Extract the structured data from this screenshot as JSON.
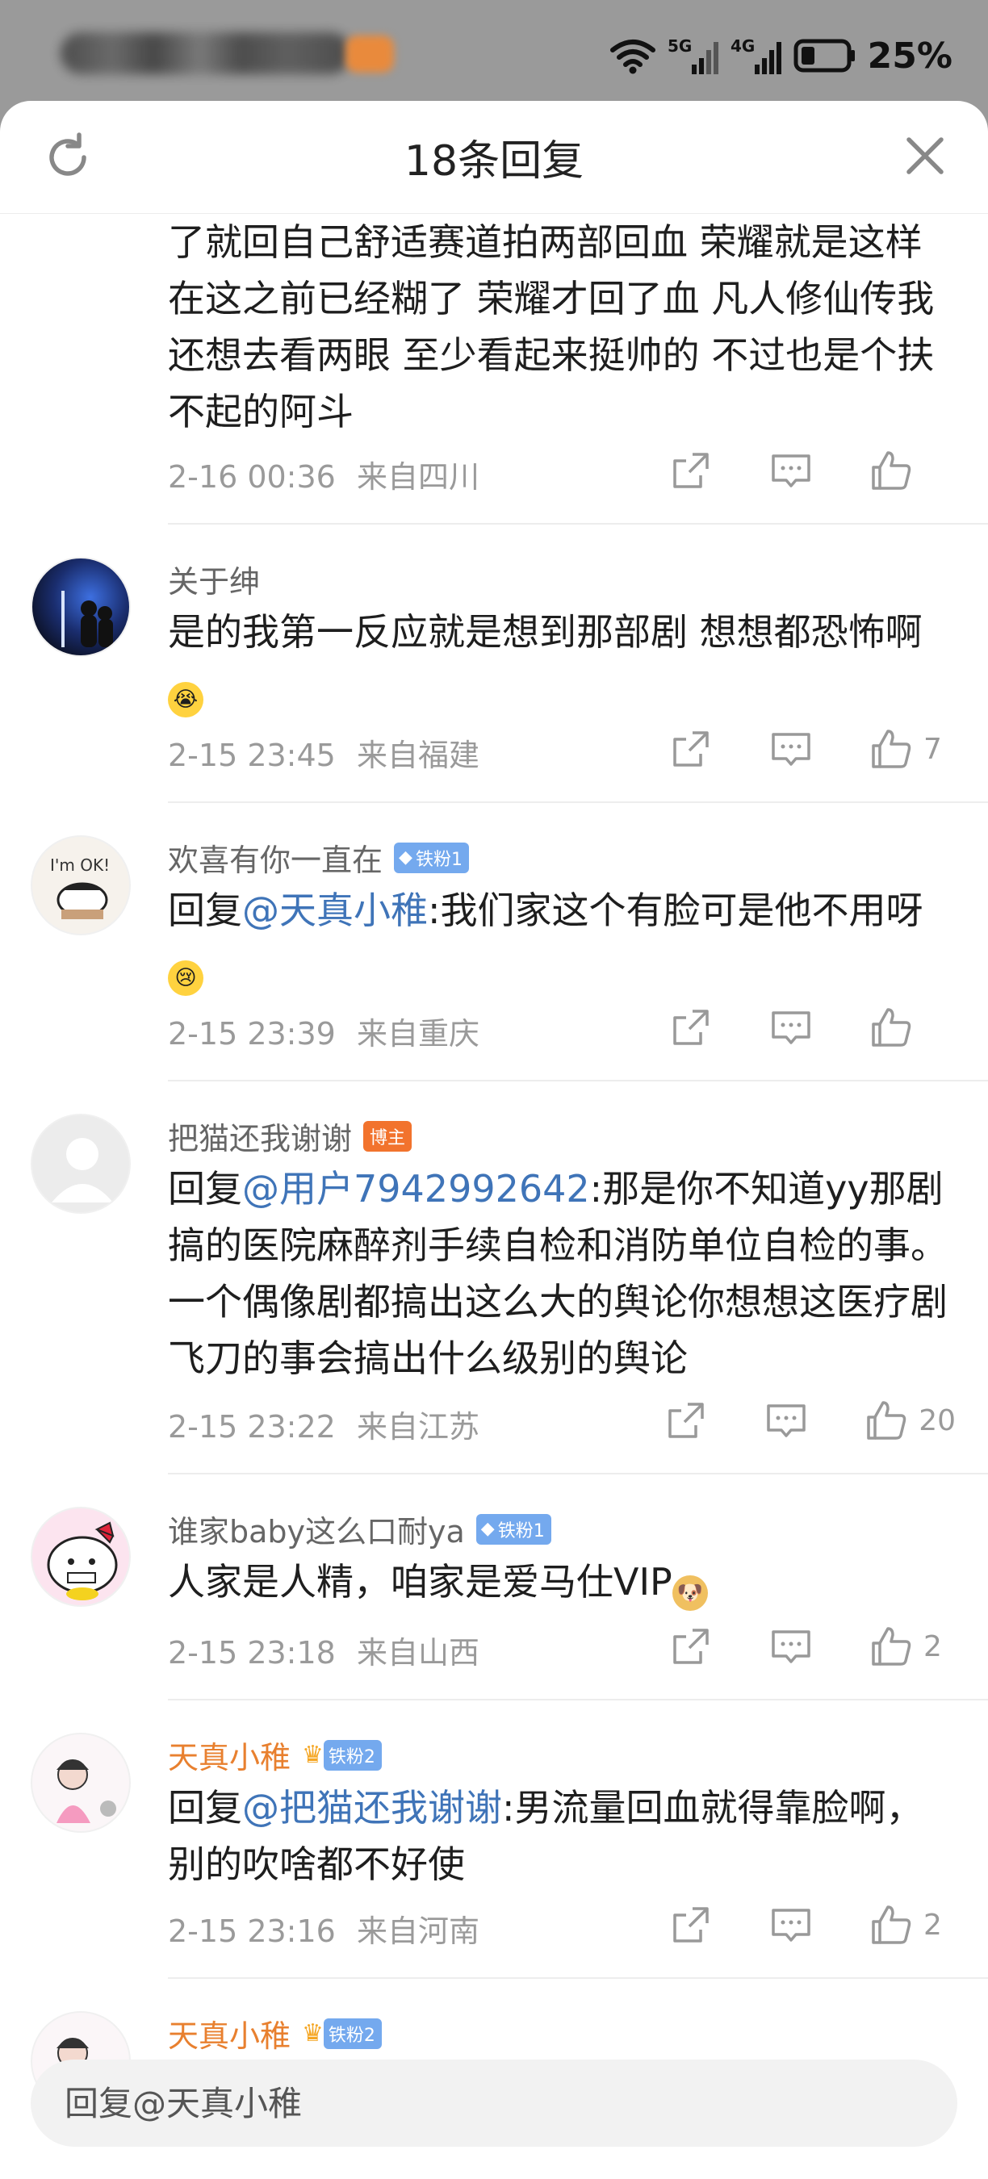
{
  "status_bar": {
    "battery": "25%",
    "net1": "5G",
    "net2": "4G"
  },
  "header": {
    "title": "18条回复"
  },
  "comments": [
    {
      "text": "了就回自己舒适赛道拍两部回血 荣耀就是这样 在这之前已经糊了 荣耀才回了血 凡人修仙传我还想去看两眼 至少看起来挺帅的 不过也是个扶不起的阿斗",
      "time": "2-16 00:36",
      "location": "来自四川",
      "likes": ""
    },
    {
      "user": "关于绅",
      "text": "是的我第一反应就是想到那部剧 想想都恐怖啊",
      "time": "2-15 23:45",
      "location": "来自福建",
      "likes": "7"
    },
    {
      "user": "欢喜有你一直在",
      "badge": "铁粉1",
      "reply_prefix": "回复",
      "mention": "@天真小稚",
      "text": ":我们家这个有脸可是他不用呀",
      "time": "2-15 23:39",
      "location": "来自重庆",
      "likes": ""
    },
    {
      "user": "把猫还我谢谢",
      "badge": "博主",
      "reply_prefix": "回复",
      "mention": "@用户7942992642",
      "text": ":那是你不知道yy那剧搞的医院麻醉剂手续自检和消防单位自检的事。一个偶像剧都搞出这么大的舆论你想想这医疗剧飞刀的事会搞出什么级别的舆论",
      "time": "2-15 23:22",
      "location": "来自江苏",
      "likes": "20"
    },
    {
      "user": "谁家baby这么口耐ya",
      "badge": "铁粉1",
      "text": "人家是人精，咱家是爱马仕VIP",
      "time": "2-15 23:18",
      "location": "来自山西",
      "likes": "2"
    },
    {
      "user": "天真小稚",
      "badge": "铁粉2",
      "reply_prefix": "回复",
      "mention": "@把猫还我谢谢",
      "text": ":男流量回血就得靠脸啊，别的吹啥都不好使",
      "time": "2-15 23:16",
      "location": "来自河南",
      "likes": "2"
    },
    {
      "user": "天真小稚",
      "badge": "铁粉2"
    }
  ],
  "input": {
    "placeholder": "回复@天真小稚"
  }
}
